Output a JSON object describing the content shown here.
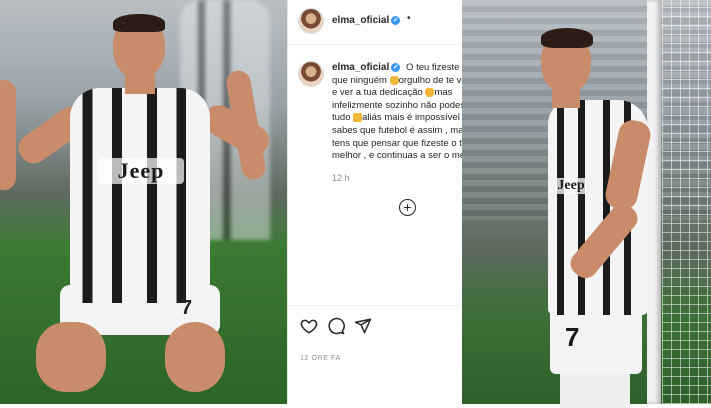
{
  "post": {
    "username": "elma_oficial",
    "verified_mark": "✓",
    "header_separator": "•",
    "caption_lines": [
      "O teu fizeste melh",
      "que ninguém",
      "orgulho de te ver",
      "e ver a tua dedicação",
      "mas",
      "infelizmente sozinho não podes f",
      "tudo",
      "aliás mais é impossível !!!",
      "sabes que futebol é assim , mas",
      "tens que pensar que fizeste o tel",
      "melhor , e continuas a ser o mell"
    ],
    "comment_time": "12 h",
    "add_icon_glyph": "+",
    "date": "12 ORE FA"
  },
  "photos": {
    "left_sponsor": "Jeep",
    "left_number": "7",
    "right_sponsor": "Jeep",
    "right_number": "7"
  },
  "icons": {
    "like": "heart-outline-icon",
    "comment": "speech-bubble-icon",
    "share": "paper-plane-icon",
    "pray_emoji": "folded-hands-emoji",
    "thumbs_down_emoji": "thumbs-down-emoji"
  },
  "colors": {
    "verified_blue": "#3897f0",
    "text_primary": "#262626",
    "text_secondary": "#8e8e8e",
    "pitch_green": "#3c7b34"
  }
}
